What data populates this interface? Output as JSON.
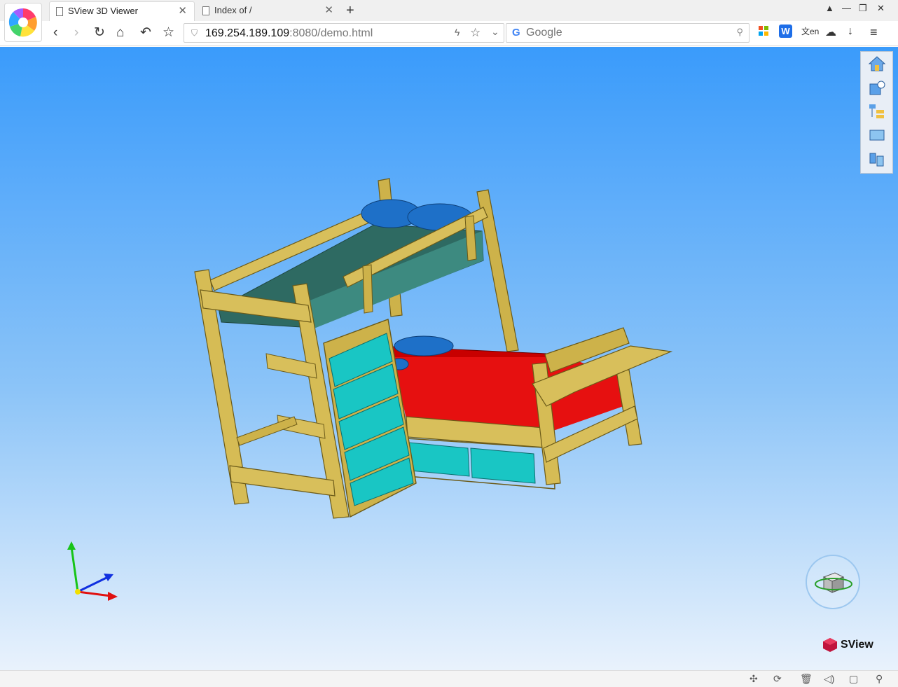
{
  "browser": {
    "tabs": [
      {
        "title": "SView 3D Viewer",
        "active": true
      },
      {
        "title": "Index of /",
        "active": false
      }
    ],
    "new_tab_icon": "plus-icon",
    "address": {
      "host": "169.254.189.109",
      "rest": ":8080/demo.html"
    },
    "search": {
      "placeholder": "Google"
    },
    "extensions": [
      "apps-icon",
      "w-icon",
      "translate-icon",
      "cloud-icon",
      "download-icon",
      "menu-icon"
    ]
  },
  "viewer": {
    "right_toolbar": [
      "home-icon",
      "cube-settings-icon",
      "tree-icon",
      "views-icon",
      "explode-icon"
    ],
    "colors": {
      "frame": "#cdb24a",
      "mattress_top": "#2e6a62",
      "mattress_bottom": "#c80000",
      "drawers": "#19c6c4",
      "pillows": "#1e70c8"
    },
    "brand": "SView"
  },
  "statusbar": {
    "icons": [
      "pin-icon",
      "rotate-icon",
      "trash-icon",
      "volume-icon",
      "window-icon",
      "zoom-icon"
    ]
  }
}
